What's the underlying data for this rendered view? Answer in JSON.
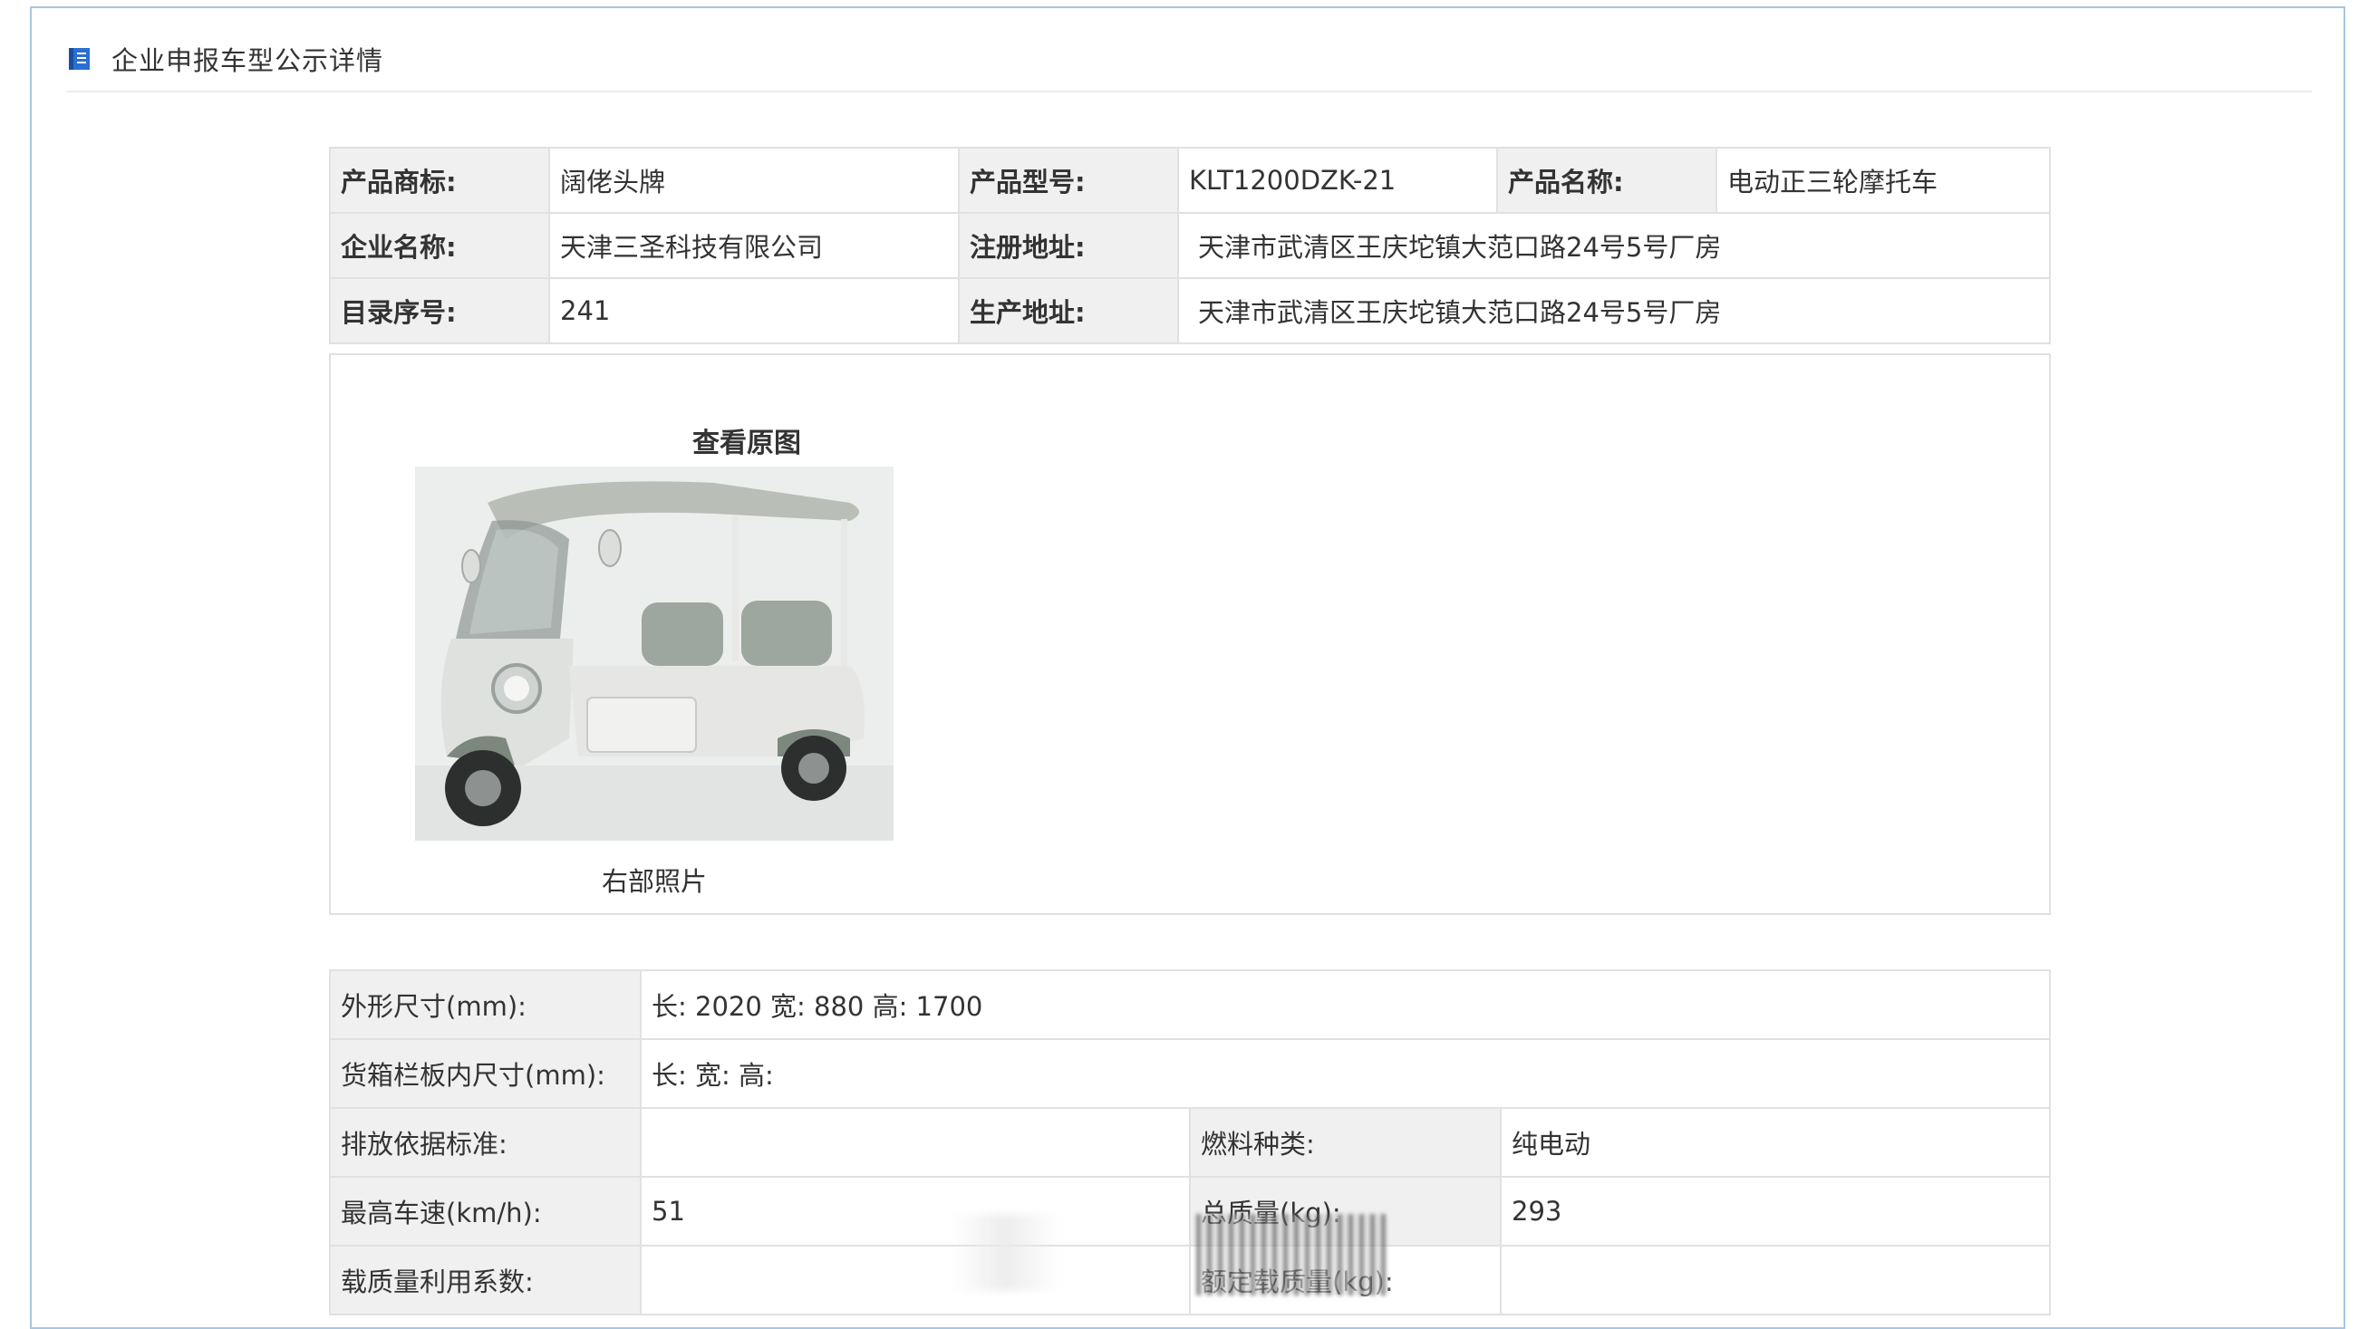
{
  "header": {
    "title": "企业申报车型公示详情"
  },
  "basic_info": {
    "rows": [
      [
        {
          "label": "产品商标:",
          "value": "阔佬头牌"
        },
        {
          "label": "产品型号:",
          "value": "KLT1200DZK-21"
        },
        {
          "label": "产品名称:",
          "value": "电动正三轮摩托车"
        }
      ],
      [
        {
          "label": "企业名称:",
          "value": "天津三圣科技有限公司"
        },
        {
          "label": "注册地址:",
          "value": "天津市武清区王庆坨镇大范口路24号5号厂房"
        }
      ],
      [
        {
          "label": "目录序号:",
          "value": "241"
        },
        {
          "label": "生产地址:",
          "value": "天津市武清区王庆坨镇大范口路24号5号厂房"
        }
      ]
    ]
  },
  "photo": {
    "link_label": "查看原图",
    "caption": "右部照片"
  },
  "specs": {
    "dimensions_label": "外形尺寸(mm):",
    "dimensions_value": "长: 2020 宽: 880 高: 1700",
    "cargo_label": "货箱栏板内尺寸(mm):",
    "cargo_value": "长:   宽:   高:",
    "emission_label": "排放依据标准:",
    "emission_value": "",
    "fuel_label": "燃料种类:",
    "fuel_value": "纯电动",
    "speed_label": "最高车速(km/h):",
    "speed_value": "51",
    "mass_label": "总质量(kg):",
    "mass_value": "293",
    "load_label": "载质量利用系数:",
    "load_value": "",
    "rated_label": "额定载质量(kg):",
    "rated_value": ""
  },
  "colors": {
    "frame_border": "#a9c6e2",
    "label_bg": "#f0f0f0",
    "icon_blue": "#2a6fd1"
  }
}
